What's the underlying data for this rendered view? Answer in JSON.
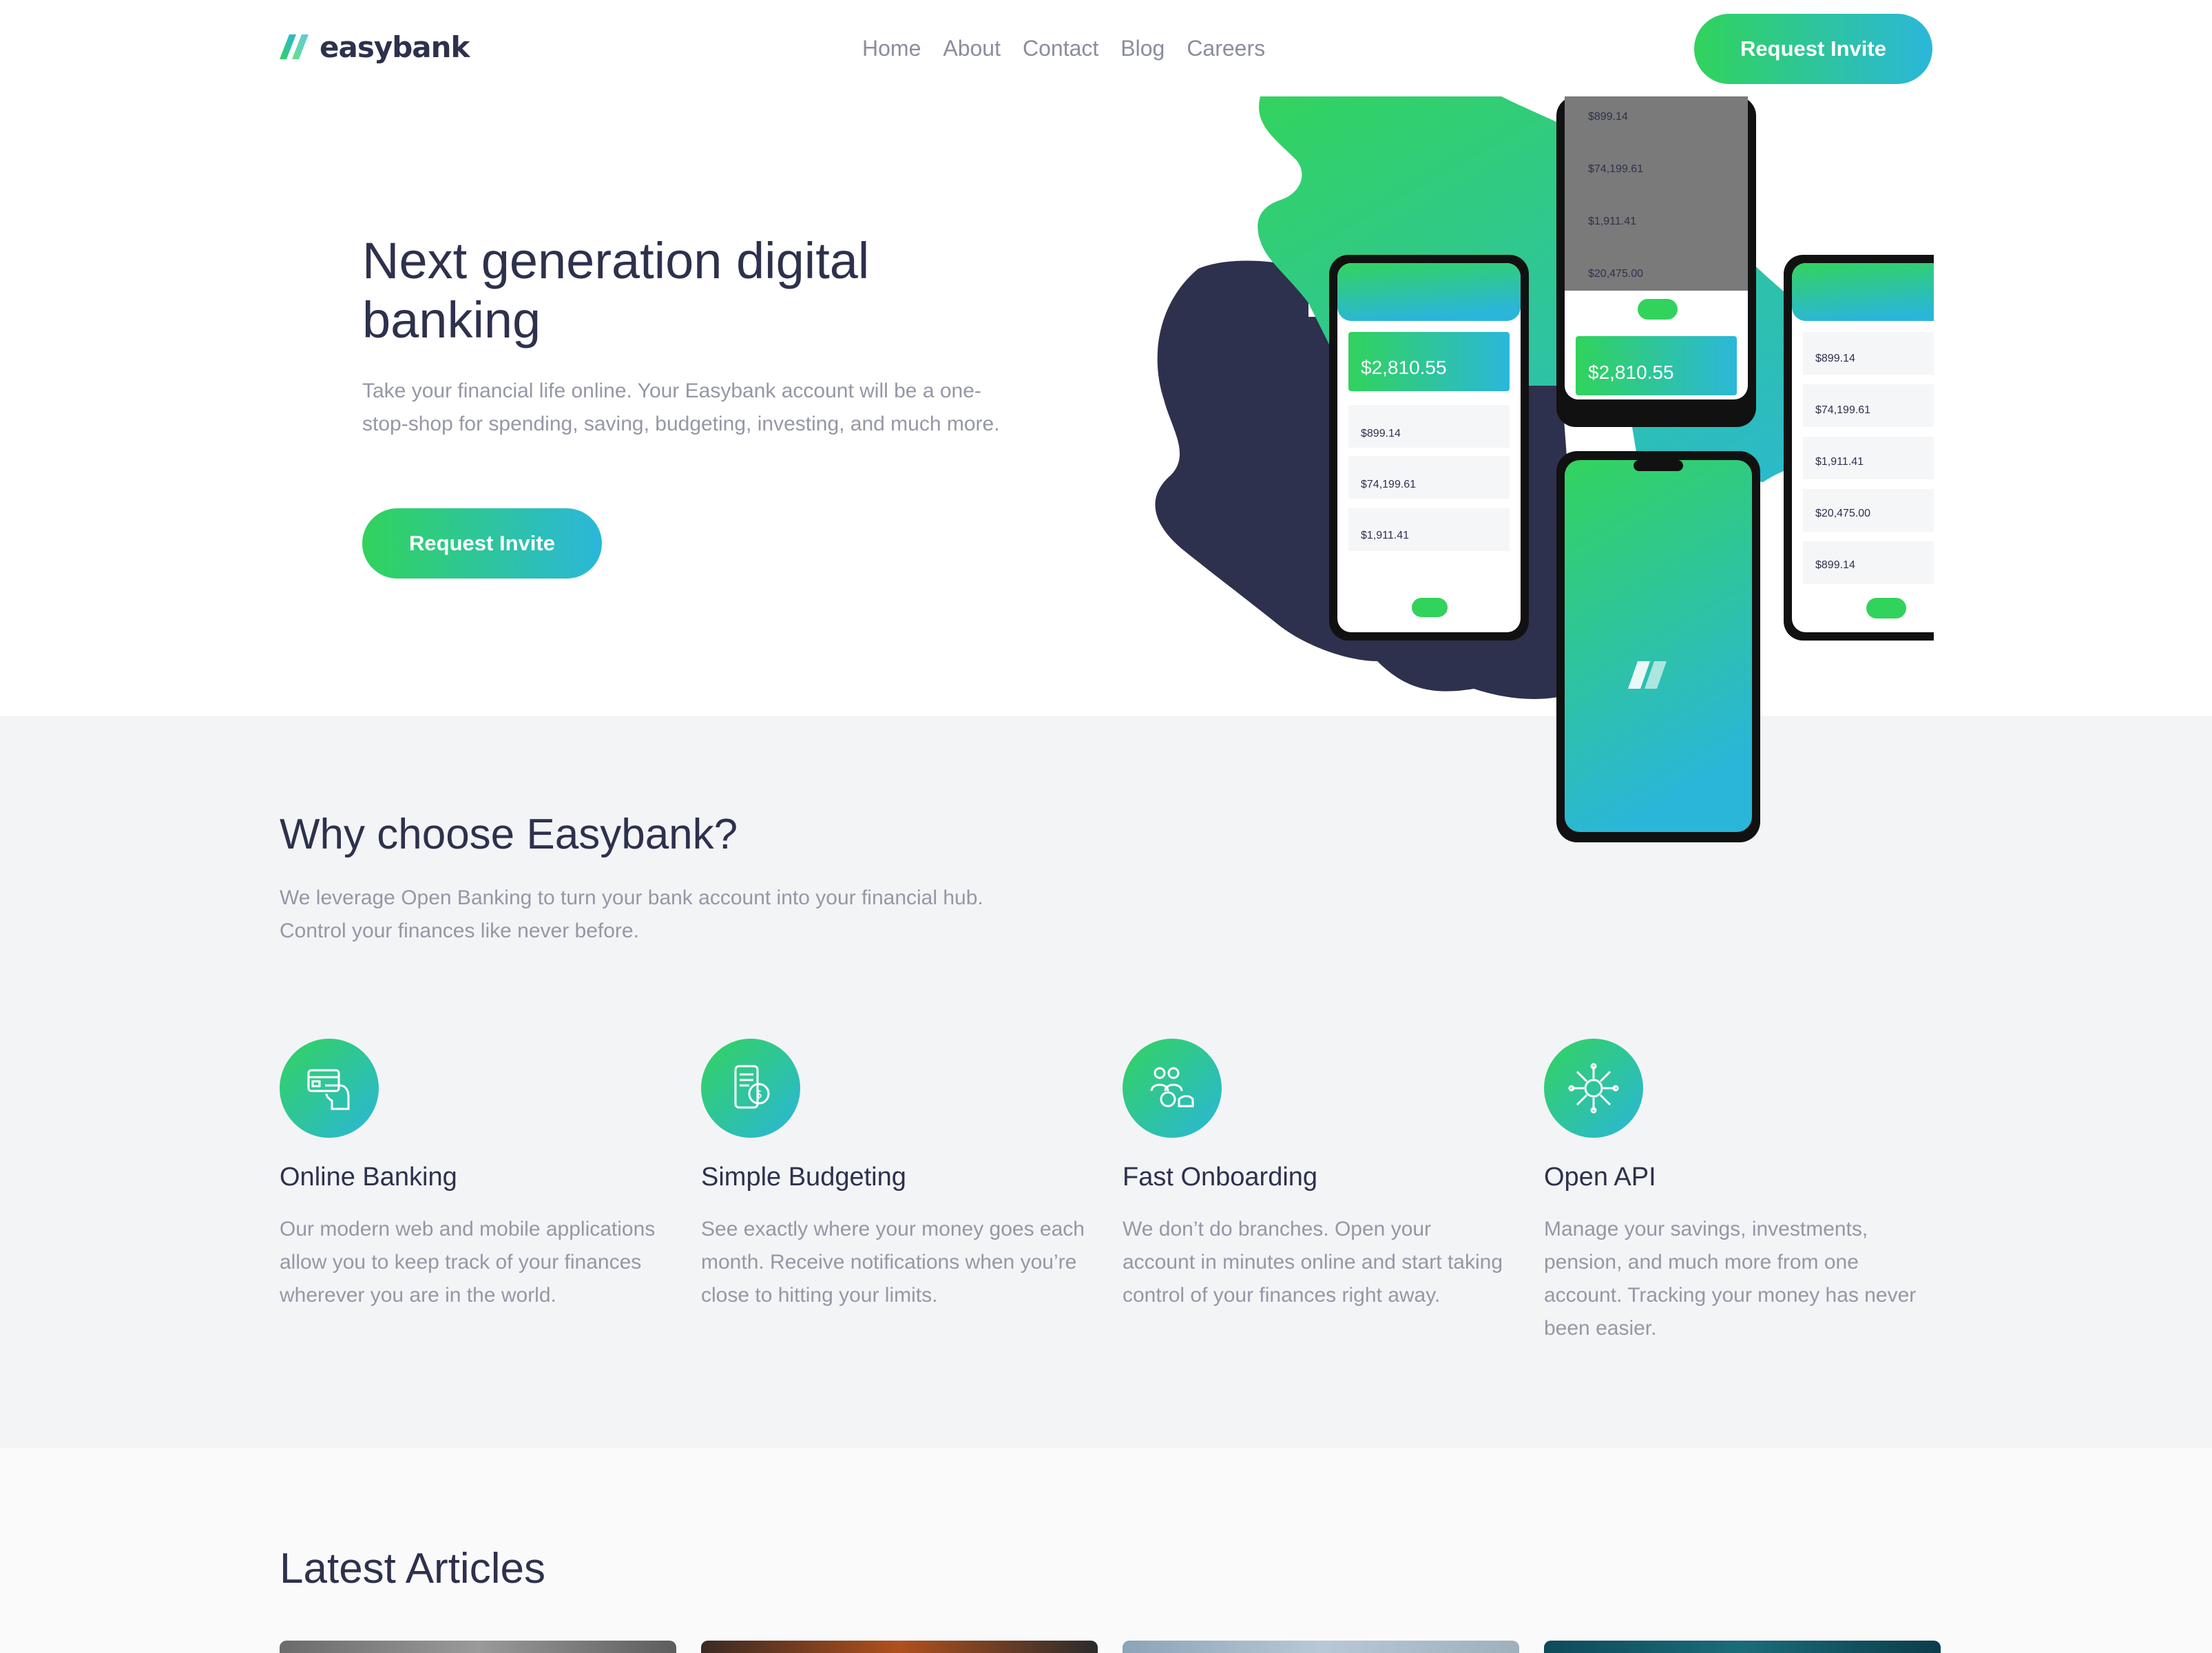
{
  "brand": {
    "name": "easybank"
  },
  "nav": {
    "items": [
      "Home",
      "About",
      "Contact",
      "Blog",
      "Careers"
    ],
    "cta_label": "Request Invite"
  },
  "hero": {
    "title": "Next generation digital banking",
    "description": "Take your financial life online. Your Easybank account will be a one-stop-shop for spending, saving, budgeting, investing, and much more.",
    "cta_label": "Request Invite"
  },
  "phone_app": {
    "balance": "$2,810.55",
    "transactions": [
      "$899.14",
      "$74,199.61",
      "$1,911.41",
      "$20,475.00"
    ]
  },
  "why": {
    "title": "Why choose Easybank?",
    "description": "We leverage Open Banking to turn your bank account into your financial hub. Control your finances like never before.",
    "features": [
      {
        "icon": "online-banking-icon",
        "title": "Online Banking",
        "text": "Our modern web and mobile applications allow you to keep track of your finances wherever you are in the world."
      },
      {
        "icon": "budgeting-icon",
        "title": "Simple Budgeting",
        "text": "See exactly where your money goes each month. Receive notifications when you’re close to hitting your limits."
      },
      {
        "icon": "onboarding-icon",
        "title": "Fast Onboarding",
        "text": "We don’t do branches. Open your account in minutes online and start taking control of your finances right away."
      },
      {
        "icon": "api-icon",
        "title": "Open API",
        "text": "Manage your savings, investments, pension, and much more from one account. Tracking your money has never been easier."
      }
    ]
  },
  "articles": {
    "title": "Latest Articles"
  },
  "colors": {
    "dark_blue": "#2d314d",
    "lime_green": "#31d35c",
    "bright_cyan": "#2bb7da",
    "grayish_blue": "#9597a6",
    "light_gray": "#f3f4f6"
  }
}
